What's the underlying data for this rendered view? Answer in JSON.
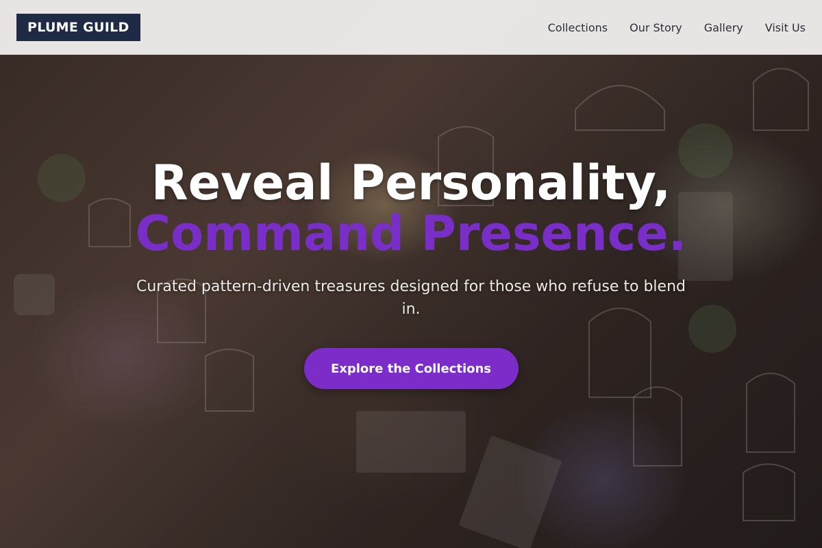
{
  "header": {
    "logo_text": "PLUME GUILD",
    "nav": [
      {
        "label": "Collections"
      },
      {
        "label": "Our Story"
      },
      {
        "label": "Gallery"
      },
      {
        "label": "Visit Us"
      }
    ]
  },
  "hero": {
    "headline_line1": "Reveal Personality,",
    "headline_line2": "Command Presence.",
    "subtitle": "Curated pattern-driven treasures designed for those who refuse to blend in.",
    "cta_label": "Explore the Collections",
    "background_image": "shop-interior-birdcages-photo"
  },
  "colors": {
    "accent": "#7b2cc9",
    "logo_background": "#1f2a44",
    "header_background": "#eeeceb",
    "nav_text": "#2c2f3a"
  }
}
